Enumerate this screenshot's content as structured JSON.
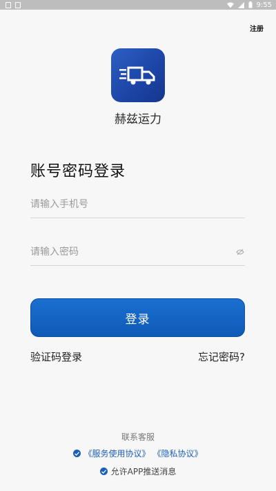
{
  "status_bar": {
    "time": "9:55"
  },
  "header": {
    "register_label": "注册"
  },
  "brand": {
    "app_name": "赫兹运力",
    "logo_color": "#1d46a8"
  },
  "login": {
    "title": "账号密码登录",
    "phone_placeholder": "请输入手机号",
    "password_placeholder": "请输入密码",
    "submit_label": "登录",
    "sms_login_label": "验证码登录",
    "forgot_password_label": "忘记密码?"
  },
  "footer": {
    "contact_label": "联系客服",
    "service_agreement": "《服务使用协议》",
    "privacy_agreement": "《隐私协议》",
    "push_consent": "允许APP推送消息"
  },
  "colors": {
    "primary": "#1467c8",
    "link": "#1d5fb8"
  }
}
